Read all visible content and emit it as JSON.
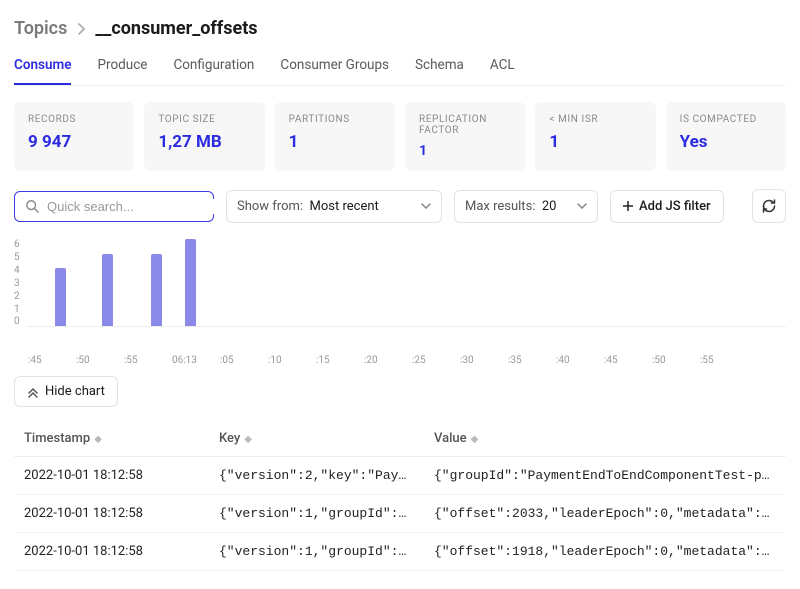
{
  "breadcrumb": {
    "root": "Topics",
    "current": "__consumer_offsets"
  },
  "tabs": [
    {
      "label": "Consume",
      "active": true
    },
    {
      "label": "Produce"
    },
    {
      "label": "Configuration"
    },
    {
      "label": "Consumer Groups"
    },
    {
      "label": "Schema"
    },
    {
      "label": "ACL"
    }
  ],
  "stats": {
    "records": {
      "label": "RECORDS",
      "value": "9 947"
    },
    "size": {
      "label": "TOPIC SIZE",
      "value": "1,27 MB"
    },
    "partitions": {
      "label": "PARTITIONS",
      "value": "1"
    },
    "rep": {
      "label": "REPLICATION FACTOR",
      "value": "1"
    },
    "minisr": {
      "label": "< MIN ISR",
      "value": "1"
    },
    "compacted": {
      "label": "IS COMPACTED",
      "value": "Yes"
    }
  },
  "controls": {
    "search_placeholder": "Quick search...",
    "showfrom_label": "Show from:",
    "showfrom_value": "Most recent",
    "maxresults_label": "Max results:",
    "maxresults_value": "20",
    "addfilter_label": "Add JS filter"
  },
  "chart_data": {
    "type": "bar",
    "y_ticks": [
      "6",
      "5",
      "4",
      "3",
      "2",
      "1",
      "0"
    ],
    "x_ticks": [
      ":45",
      ":50",
      ":55",
      "06:13",
      ":05",
      ":10",
      ":15",
      ":20",
      ":25",
      ":30",
      ":35",
      ":40",
      ":45",
      ":50",
      ":55"
    ],
    "bars": [
      {
        "x_pct": 3.8,
        "value": 4
      },
      {
        "x_pct": 10.0,
        "value": 5
      },
      {
        "x_pct": 16.5,
        "value": 5
      },
      {
        "x_pct": 21.0,
        "value": 6
      }
    ],
    "ymax": 6
  },
  "hidechart_label": "Hide chart",
  "table": {
    "headers": [
      "Timestamp",
      "Key",
      "Value"
    ],
    "rows": [
      {
        "ts": "2022-10-01 18:12:58",
        "key": "{\"version\":2,\"key\":\"Paym…",
        "val": "{\"groupId\":\"PaymentEndToEndComponentTest-pay…"
      },
      {
        "ts": "2022-10-01 18:12:58",
        "key": "{\"version\":1,\"groupId\":\"…",
        "val": "{\"offset\":2033,\"leaderEpoch\":0,\"metadata\":\"\"…"
      },
      {
        "ts": "2022-10-01 18:12:58",
        "key": "{\"version\":1,\"groupId\":\"…",
        "val": "{\"offset\":1918,\"leaderEpoch\":0,\"metadata\":\"\"…"
      }
    ]
  }
}
